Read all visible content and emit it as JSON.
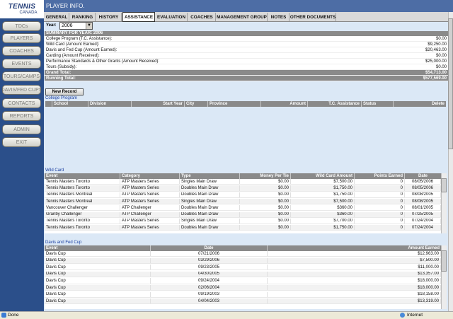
{
  "logo": {
    "line1": "TENNIS",
    "line2": "CANADA"
  },
  "sidebar": {
    "items": [
      "TDCs",
      "PLAYERS",
      "COACHES",
      "EVENTS",
      "TOURS/CAMPS",
      "DAVIS/FED CUPS",
      "CONTACTS",
      "REPORTS",
      "ADMIN",
      "EXIT"
    ]
  },
  "header": {
    "title": "PLAYER INFO."
  },
  "tabs": [
    "GENERAL",
    "RANKING",
    "HISTORY",
    "ASSISTANCE",
    "EVALUATION",
    "COACHES",
    "MANAGEMENT GROUP",
    "NOTES",
    "OTHER DOCUMENTS"
  ],
  "active_tab": "ASSISTANCE",
  "year": {
    "label": "Year:",
    "value": "2006"
  },
  "summary": {
    "title": "SUMMARY FOR YEAR: 2006",
    "rows": [
      {
        "label": "College Program (T.C. Assistance):",
        "value": "$0.00"
      },
      {
        "label": "Wild Card (Amount Earned):",
        "value": "$9,250.00"
      },
      {
        "label": "Davis and Fed Cup (Amount Earned):",
        "value": "$20,463.00"
      },
      {
        "label": "Carding (Amount Received):",
        "value": "$0.00"
      },
      {
        "label": "Performance Standards & Other Grants (Amount Received):",
        "value": "$25,000.00"
      },
      {
        "label": "Tours (Subsidy):",
        "value": "$0.00"
      }
    ],
    "grand_total": {
      "label": "Grand Total:",
      "value": "$54,713.00"
    },
    "running_total": {
      "label": "Running Total:",
      "value": "$577,569.00"
    }
  },
  "new_record_label": "New Record",
  "college": {
    "title": "College Program",
    "columns": [
      "School",
      "Division",
      "Start Year",
      "City",
      "Province",
      "Amount",
      "T.C. Assistance",
      "Status",
      "Delete"
    ]
  },
  "wildcard": {
    "title": "Wild Card",
    "columns": [
      "Event",
      "Category",
      "Type",
      "Money Per Tie",
      "Wild Card Amount",
      "Points Earned",
      "Date"
    ],
    "rows": [
      [
        "Tennis Masters Toronto",
        "ATP Masters Series",
        "Singles Main Draw",
        "$0.00",
        "$7,500.00",
        "0",
        "08/05/2006"
      ],
      [
        "Tennis Masters Toronto",
        "ATP Masters Series",
        "Doubles Main Draw",
        "$0.00",
        "$1,750.00",
        "0",
        "08/05/2006"
      ],
      [
        "Tennis Masters Montreal",
        "ATP Masters Series",
        "Doubles Main Draw",
        "$0.00",
        "$1,750.00",
        "0",
        "08/08/2005"
      ],
      [
        "Tennis Masters Montreal",
        "ATP Masters Series",
        "Singles Main Draw",
        "$0.00",
        "$7,500.00",
        "0",
        "08/08/2005"
      ],
      [
        "Vancouver Challenger",
        "ATP Challenger",
        "Doubles Main Draw",
        "$0.00",
        "$360.00",
        "0",
        "08/01/2005"
      ],
      [
        "Granby Challenger",
        "ATP Challenger",
        "Doubles Main Draw",
        "$0.00",
        "$360.00",
        "0",
        "07/25/2005"
      ],
      [
        "Tennis Masters Toronto",
        "ATP Masters Series",
        "Singles Main Draw",
        "$0.00",
        "$7,700.00",
        "0",
        "07/24/2004"
      ],
      [
        "Tennis Masters Toronto",
        "ATP Masters Series",
        "Doubles Main Draw",
        "$0.00",
        "$1,750.00",
        "0",
        "07/24/2004"
      ]
    ]
  },
  "davis": {
    "title": "Davis and Fed Cup",
    "columns": [
      "Event",
      "Date",
      "Amount Earned"
    ],
    "rows": [
      [
        "Davis Cup",
        "07/21/2006",
        "$12,963.00"
      ],
      [
        "Davis Cup",
        "03/29/2006",
        "$7,500.00"
      ],
      [
        "Davis Cup",
        "09/23/2005",
        "$11,000.00"
      ],
      [
        "Davis Cup",
        "04/30/2005",
        "$13,357.00"
      ],
      [
        "Davis Cup",
        "09/24/2004",
        "$18,000.00"
      ],
      [
        "Davis Cup",
        "02/06/2004",
        "$18,000.00"
      ],
      [
        "Davis Cup",
        "09/19/2003",
        "$18,158.00"
      ],
      [
        "Davis Cup",
        "04/04/2003",
        "$13,319.00"
      ]
    ]
  },
  "status": {
    "left": "Done",
    "zone": "Internet"
  }
}
